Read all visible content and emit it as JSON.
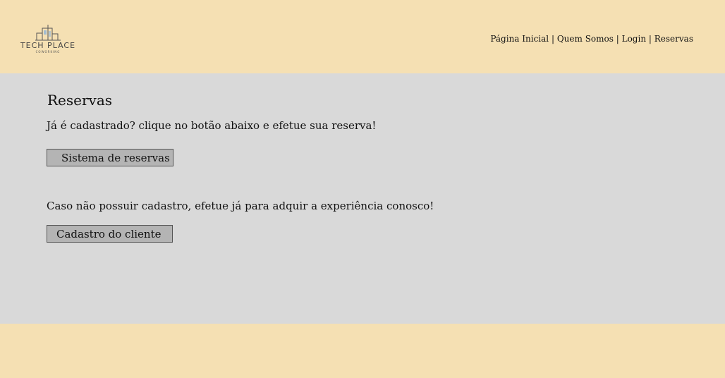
{
  "header": {
    "logo": {
      "title": "TECH PLACE",
      "subtitle": "COWORKING"
    },
    "nav": {
      "items": [
        "Página Inicial",
        "Quem Somos",
        "Login",
        "Reservas"
      ],
      "separator": "|"
    }
  },
  "main": {
    "title": "Reservas",
    "registered_text": "Já é cadastrado? clique no botão abaixo e efetue sua reserva!",
    "reservation_button": "Sistema de reservas",
    "unregistered_text": "Caso não possuir cadastro, efetue já para adquir a experiência conosco!",
    "register_button": "Cadastro do cliente"
  },
  "colors": {
    "header_bg": "#f5e0b3",
    "main_bg": "#d9d9d9",
    "button_bg": "#b4b4b4"
  }
}
